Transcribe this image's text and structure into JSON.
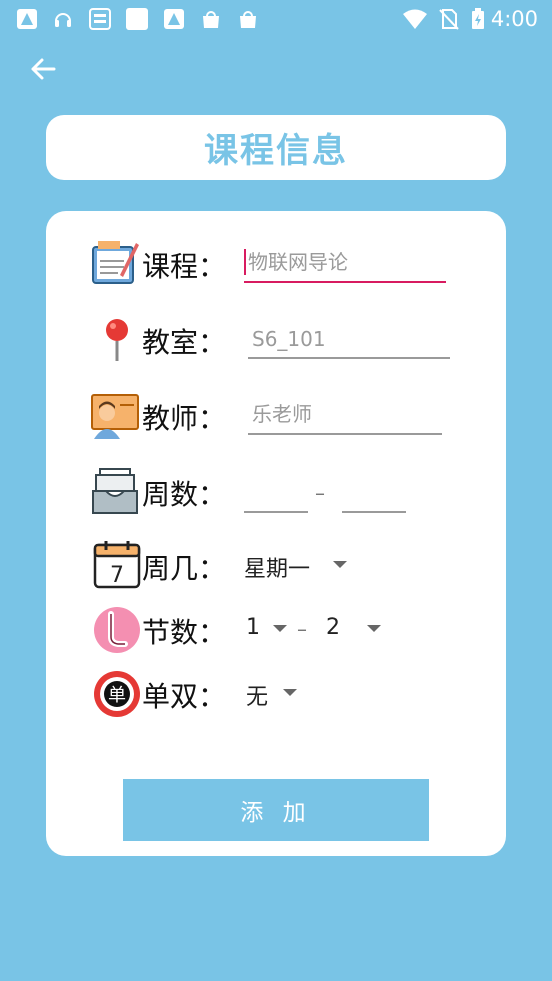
{
  "status_bar": {
    "time": "4:00",
    "left_icons": [
      "app-icon",
      "headset-icon",
      "game-hall-icon",
      "app-icon",
      "app-icon",
      "bag-icon",
      "bag-icon"
    ],
    "right_icons": [
      "wifi-icon",
      "no-sim-icon",
      "battery-charging-icon"
    ]
  },
  "header": {
    "title": "课程信息"
  },
  "form": {
    "course": {
      "label": "课程：",
      "placeholder": "物联网导论",
      "icon": "notebook-icon"
    },
    "classroom": {
      "label": "教室：",
      "placeholder": "S6_101",
      "icon": "location-pin-icon"
    },
    "teacher": {
      "label": "教师：",
      "placeholder": "乐老师",
      "icon": "teacher-icon"
    },
    "weeks": {
      "label": "周数：",
      "separator": "–",
      "start": "",
      "end": "",
      "icon": "inbox-tray-icon"
    },
    "weekday": {
      "label": "周几：",
      "value": "星期一",
      "icon": "calendar-icon",
      "calendar_day": "7"
    },
    "periods": {
      "label": "节数：",
      "start": "1",
      "separator": "–",
      "end": "2",
      "icon": "clock-icon"
    },
    "odd_even": {
      "label": "单双：",
      "value": "无",
      "icon": "single-badge-icon",
      "badge_text": "单"
    },
    "add_button": "添 加"
  },
  "colors": {
    "background": "#79C4E6",
    "card": "#FFFFFF",
    "accent_underline": "#D81B60",
    "button": "#79C4E6"
  }
}
